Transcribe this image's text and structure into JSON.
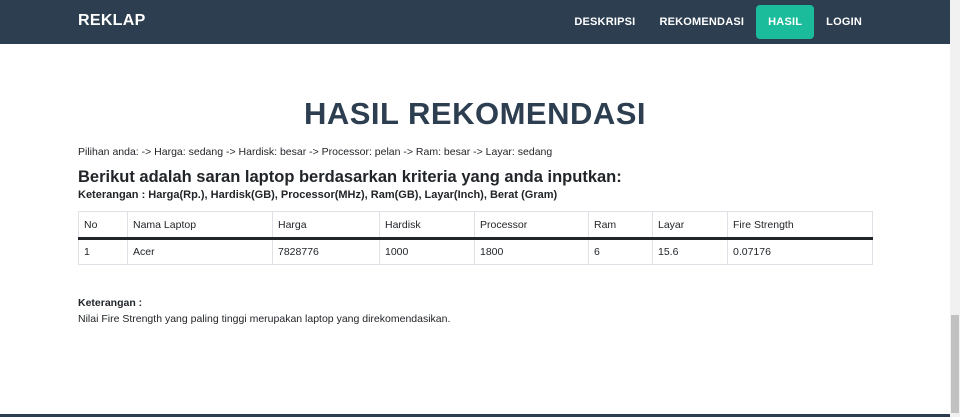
{
  "navbar": {
    "brand": "REKLAP",
    "links": [
      {
        "label": "DESKRIPSI",
        "active": false
      },
      {
        "label": "REKOMENDASI",
        "active": false
      },
      {
        "label": "HASIL",
        "active": true
      },
      {
        "label": "LOGIN",
        "active": false
      }
    ],
    "bg_color": "#2c3e50",
    "active_color": "#1abc9c"
  },
  "main": {
    "title": "HASIL REKOMENDASI",
    "choices": "Pilihan anda: -> Harga: sedang -> Hardisk: besar -> Processor: pelan -> Ram: besar -> Layar: sedang",
    "subheading": "Berikut adalah saran laptop berdasarkan kriteria yang anda inputkan:",
    "legend": "Keterangan : Harga(Rp.), Hardisk(GB), Processor(MHz), Ram(GB), Layar(Inch), Berat (Gram)"
  },
  "table": {
    "headers": [
      "No",
      "Nama Laptop",
      "Harga",
      "Hardisk",
      "Processor",
      "Ram",
      "Layar",
      "Fire Strength"
    ],
    "rows": [
      [
        "1",
        "Acer",
        "7828776",
        "1000",
        "1800",
        "6",
        "15.6",
        "0.07176"
      ]
    ]
  },
  "note": {
    "title": "Keterangan :",
    "text": "Nilai Fire Strength yang paling tinggi merupakan laptop yang direkomendasikan."
  }
}
